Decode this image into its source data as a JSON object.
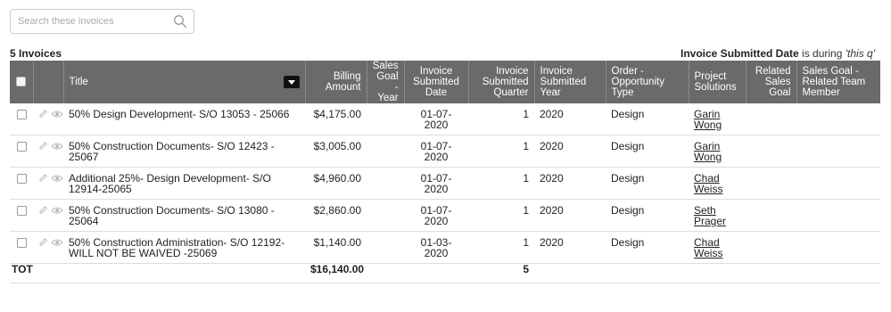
{
  "search": {
    "placeholder": "Search these invoices",
    "value": ""
  },
  "summary": {
    "count_label": "5 Invoices",
    "filter_field": "Invoice Submitted Date",
    "filter_text": " is during ",
    "filter_value": "'this q'"
  },
  "columns": {
    "title": "Title",
    "billing_amount": "Billing Amount",
    "sales_goal_year": "Sales Goal - Year",
    "invoice_submitted_date": "Invoice Submitted Date",
    "invoice_submitted_quarter": "Invoice Submitted Quarter",
    "invoice_submitted_year": "Invoice Submitted Year",
    "order_opportunity_type": "Order - Opportunity Type",
    "project_solutions": "Project Solutions",
    "related_sales_goal": "Related Sales Goal",
    "sales_goal_team_member": "Sales Goal - Related Team Member"
  },
  "rows": [
    {
      "title": "50% Design Development- S/O 13053 - 25066",
      "billing_amount": "$4,175.00",
      "sales_goal_year": "",
      "date": "01-07-2020",
      "quarter": "1",
      "year": "2020",
      "type": "Design",
      "project_solutions": "Garin Wong",
      "related_sales_goal": "",
      "team_member": ""
    },
    {
      "title": "50% Construction Documents- S/O 12423 - 25067",
      "billing_amount": "$3,005.00",
      "sales_goal_year": "",
      "date": "01-07-2020",
      "quarter": "1",
      "year": "2020",
      "type": "Design",
      "project_solutions": "Garin Wong",
      "related_sales_goal": "",
      "team_member": ""
    },
    {
      "title": "Additional 25%- Design Development- S/O 12914-25065",
      "billing_amount": "$4,960.00",
      "sales_goal_year": "",
      "date": "01-07-2020",
      "quarter": "1",
      "year": "2020",
      "type": "Design",
      "project_solutions": "Chad Weiss",
      "related_sales_goal": "",
      "team_member": ""
    },
    {
      "title": "50% Construction Documents- S/O 13080 - 25064",
      "billing_amount": "$2,860.00",
      "sales_goal_year": "",
      "date": "01-07-2020",
      "quarter": "1",
      "year": "2020",
      "type": "Design",
      "project_solutions": "Seth Prager",
      "related_sales_goal": "",
      "team_member": ""
    },
    {
      "title": "50% Construction Administration- S/O 12192- WILL NOT BE WAIVED -25069",
      "billing_amount": "$1,140.00",
      "sales_goal_year": "",
      "date": "01-03-2020",
      "quarter": "1",
      "year": "2020",
      "type": "Design",
      "project_solutions": "Chad Weiss",
      "related_sales_goal": "",
      "team_member": ""
    }
  ],
  "totals": {
    "label": "TOT",
    "billing_amount": "$16,140.00",
    "quarter": "5"
  },
  "colors": {
    "header_bg": "#6a6a6a",
    "header_text": "#ffffff",
    "row_border": "#dddddd",
    "icon_gray": "#b9b9b9"
  },
  "icons": {
    "search": "search-icon",
    "edit": "pencil-icon",
    "view": "eye-icon",
    "sort": "dropdown-caret-icon"
  }
}
